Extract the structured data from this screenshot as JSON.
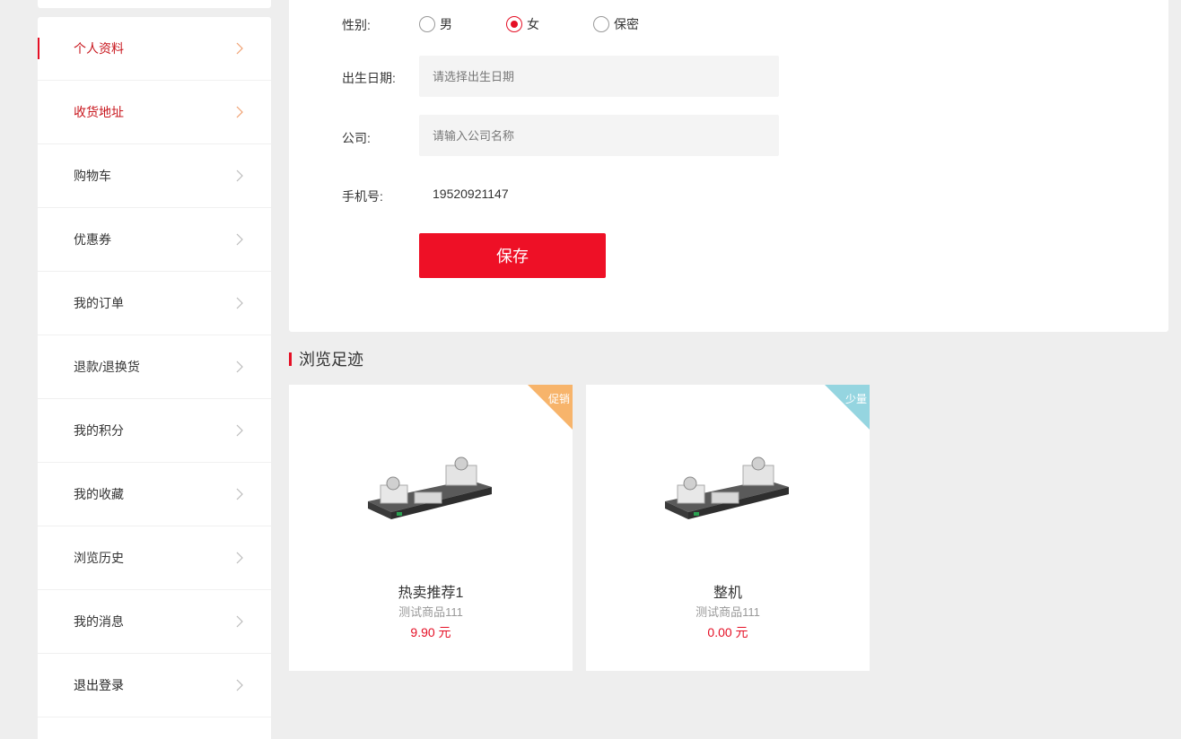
{
  "sidebar": {
    "items": [
      {
        "label": "个人资料"
      },
      {
        "label": "收货地址"
      },
      {
        "label": "购物车"
      },
      {
        "label": "优惠券"
      },
      {
        "label": "我的订单"
      },
      {
        "label": "退款/退换货"
      },
      {
        "label": "我的积分"
      },
      {
        "label": "我的收藏"
      },
      {
        "label": "浏览历史"
      },
      {
        "label": "我的消息"
      },
      {
        "label": "退出登录"
      }
    ]
  },
  "form": {
    "gender": {
      "label": "性别:",
      "options": [
        "男",
        "女",
        "保密"
      ],
      "selected": "女"
    },
    "birthday": {
      "label": "出生日期:",
      "placeholder": "请选择出生日期"
    },
    "company": {
      "label": "公司:",
      "placeholder": "请输入公司名称"
    },
    "phone": {
      "label": "手机号:",
      "value": "19520921147"
    },
    "save_label": "保存"
  },
  "history": {
    "title": "浏览足迹",
    "products": [
      {
        "badge": "促销",
        "badge_color": "#f7b46b",
        "name": "热卖推荐1",
        "desc": "测试商品111",
        "price": "9.90 元"
      },
      {
        "badge": "少量",
        "badge_color": "#95d5e0",
        "name": "整机",
        "desc": "测试商品111",
        "price": "0.00 元"
      }
    ]
  },
  "colors": {
    "accent": "#e50f25",
    "background": "#eeeeee"
  }
}
